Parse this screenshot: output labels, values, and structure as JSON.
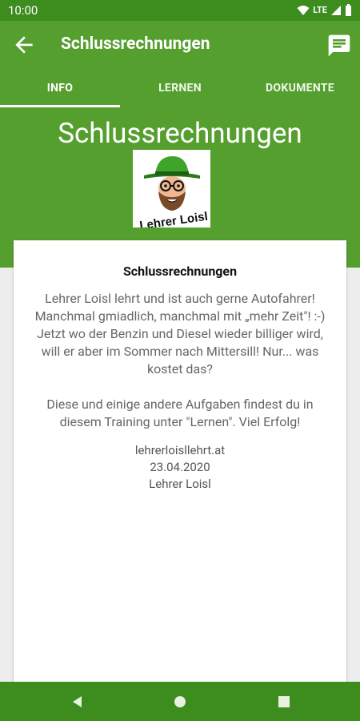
{
  "status_bar": {
    "time": "10:00",
    "network": "LTE",
    "icons": [
      "wifi-icon",
      "cellular-icon",
      "battery-icon"
    ]
  },
  "app_bar": {
    "title": "Schlussrechnungen",
    "back_icon": "arrow-back-icon",
    "action_icon": "message-icon"
  },
  "tabs": [
    {
      "label": "INFO",
      "active": true
    },
    {
      "label": "LERNEN",
      "active": false
    },
    {
      "label": "DOKUMENTE",
      "active": false
    }
  ],
  "hero": {
    "title": "Schlussrechnungen",
    "logo_text": "Lehrer Loisl"
  },
  "card": {
    "title": "Schlussrechnungen",
    "description": "Lehrer Loisl lehrt und ist auch gerne Autofahrer! Manchmal gmiadlich, manchmal mit „mehr Zeit\"! :-) Jetzt wo der Benzin und Diesel wieder billiger wird, will er aber im Sommer nach Mittersill! Nur... was kostet das?\n\nDiese und einige andere Aufgaben findest du in diesem Training unter \"Lernen\". Viel Erfolg!",
    "website": "lehrerloisllehrt.at",
    "date": "23.04.2020",
    "author": "Lehrer Loisl"
  },
  "colors": {
    "primary": "#559f2f",
    "primary_dark": "#3c8c1e",
    "background": "#ededed"
  },
  "nav_bar": {
    "icons": [
      "back-triangle-icon",
      "home-circle-icon",
      "recents-square-icon"
    ]
  }
}
